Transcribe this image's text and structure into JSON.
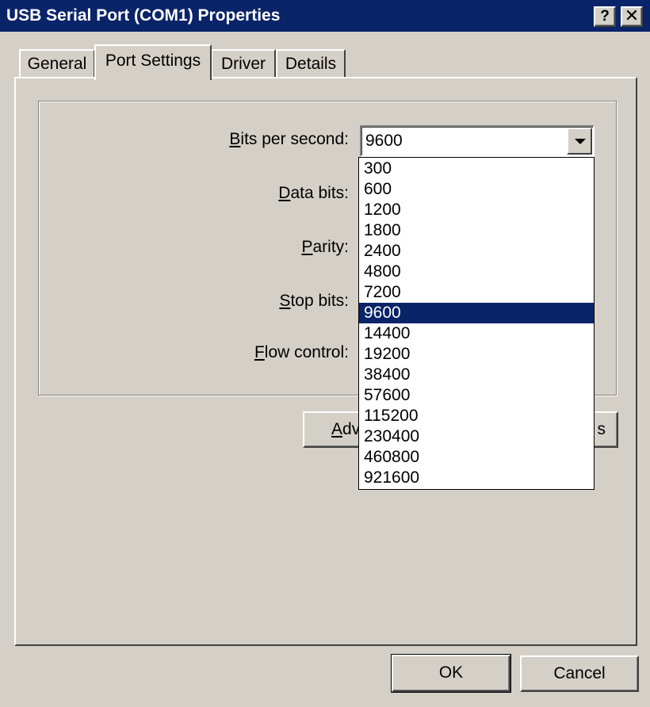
{
  "window": {
    "title": "USB Serial Port (COM1) Properties",
    "help_glyph": "?",
    "close_glyph": "✕"
  },
  "tabs": [
    {
      "label": "General",
      "active": false
    },
    {
      "label": "Port Settings",
      "active": true
    },
    {
      "label": "Driver",
      "active": false
    },
    {
      "label": "Details",
      "active": false
    }
  ],
  "port_settings": {
    "fields": {
      "bits_per_second": {
        "mnemonic": "B",
        "rest": "its per second:"
      },
      "data_bits": {
        "mnemonic": "D",
        "rest": "ata bits:"
      },
      "parity": {
        "mnemonic": "P",
        "rest": "arity:"
      },
      "stop_bits": {
        "mnemonic": "S",
        "rest": "top bits:"
      },
      "flow_control": {
        "mnemonic": "F",
        "rest": "low control:"
      }
    },
    "bits_per_second_value": "9600",
    "bits_per_second_options": [
      "300",
      "600",
      "1200",
      "1800",
      "2400",
      "4800",
      "7200",
      "9600",
      "14400",
      "19200",
      "38400",
      "57600",
      "115200",
      "230400",
      "460800",
      "921600"
    ],
    "selected_option": "9600",
    "advanced_button": {
      "visible_left": "Adv",
      "visible_right": "s"
    }
  },
  "footer": {
    "ok_label": "OK",
    "cancel_label": "Cancel"
  },
  "colors": {
    "titlebar": "#0a246a",
    "face": "#d4d0c8",
    "selection": "#0a246a"
  }
}
